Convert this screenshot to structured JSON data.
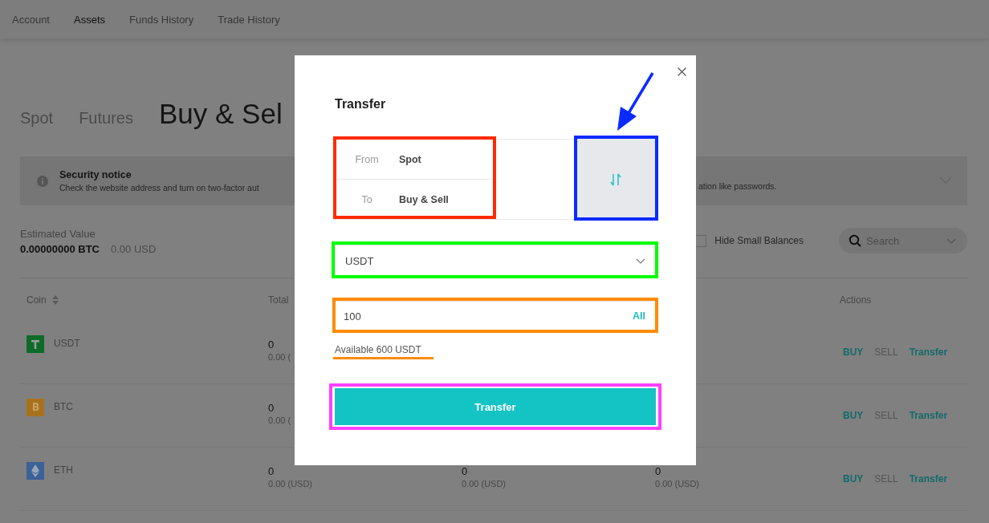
{
  "nav": [
    {
      "label": "Account",
      "selected": false
    },
    {
      "label": "Assets",
      "selected": true
    },
    {
      "label": "Funds History",
      "selected": false
    },
    {
      "label": "Trade History",
      "selected": false
    }
  ],
  "account_tabs": [
    {
      "label": "Spot",
      "selected": false
    },
    {
      "label": "Futures",
      "selected": false
    },
    {
      "label": "Buy & Sel",
      "selected": true
    }
  ],
  "notice": {
    "title": "Security notice",
    "text_left": "Check the website address and turn on two-factor aut",
    "text_right": "ation like passwords."
  },
  "estimated": {
    "label": "Estimated Value",
    "btc": "0.00000000 BTC",
    "usd": "0.00 USD"
  },
  "hide_small": {
    "label": "Hide Small Balances",
    "checked": false
  },
  "search": {
    "placeholder": "Search"
  },
  "table": {
    "columns": [
      "Coin",
      "Total",
      "Actions"
    ],
    "rows": [
      {
        "coin": "USDT",
        "color": "#0d6b27",
        "total": {
          "amount": "0",
          "usd": "0.00 ("
        },
        "actions": [
          {
            "label": "BUY",
            "disabled": false
          },
          {
            "label": "SELL",
            "disabled": true
          },
          {
            "label": "Transfer",
            "disabled": false
          }
        ]
      },
      {
        "coin": "BTC",
        "color": "#a8721c",
        "total": {
          "amount": "0",
          "usd": "0.00 ("
        },
        "actions": [
          {
            "label": "BUY",
            "disabled": false
          },
          {
            "label": "SELL",
            "disabled": true
          },
          {
            "label": "Transfer",
            "disabled": false
          }
        ]
      },
      {
        "coin": "ETH",
        "color": "#3a6198",
        "total": {
          "amount": "0",
          "usd": "0.00 (USD)"
        },
        "column_3": {
          "amount": "0",
          "usd": "0.00 (USD)"
        },
        "column_4": {
          "amount": "0",
          "usd": "0.00 (USD)"
        },
        "actions": [
          {
            "label": "BUY",
            "disabled": false
          },
          {
            "label": "SELL",
            "disabled": true
          },
          {
            "label": "Transfer",
            "disabled": false
          }
        ]
      }
    ]
  },
  "modal": {
    "title": "Transfer",
    "route": [
      {
        "label": "From",
        "value": "Spot"
      },
      {
        "label": "To",
        "value": "Buy & Sell"
      }
    ],
    "route_highlight": {
      "color": "#ff2a00"
    },
    "swap_highlight": {
      "color": "#0a2bff"
    },
    "coin_select": {
      "value": "USDT",
      "highlight": {
        "color": "#00ff00"
      }
    },
    "amount": {
      "value": "100",
      "all_label": "All",
      "highlight": {
        "color": "#ff8c00"
      }
    },
    "available": {
      "text": "Available 600 USDT"
    },
    "submit": {
      "label": "Transfer",
      "highlight": {
        "color": "#ff40ff"
      }
    }
  }
}
